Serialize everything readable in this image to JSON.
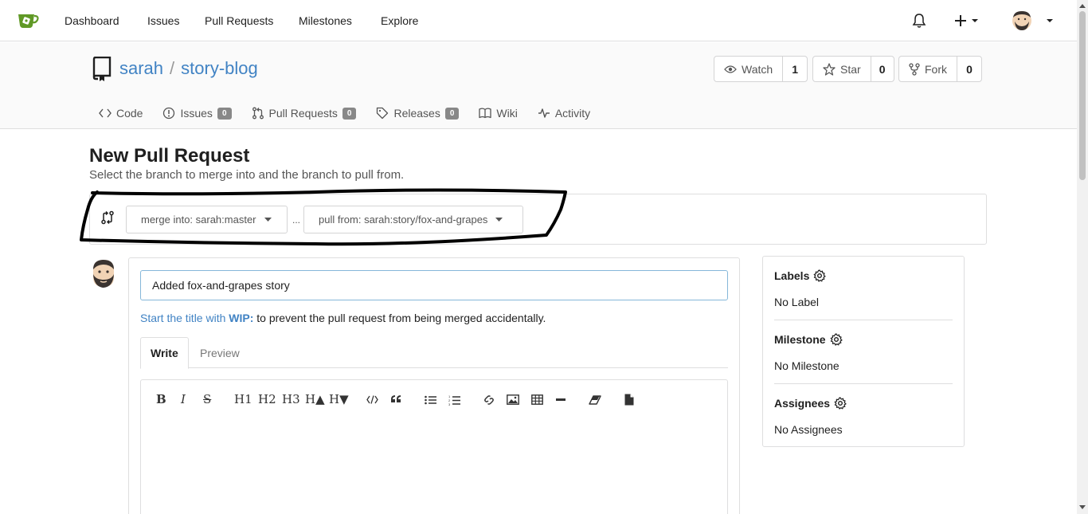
{
  "nav": {
    "items": [
      "Dashboard",
      "Issues",
      "Pull Requests",
      "Milestones",
      "Explore"
    ]
  },
  "repo": {
    "owner": "sarah",
    "separator": "/",
    "name": "story-blog",
    "watch_label": "Watch",
    "watch_count": "1",
    "star_label": "Star",
    "star_count": "0",
    "fork_label": "Fork",
    "fork_count": "0",
    "tabs": [
      {
        "label": "Code",
        "count": ""
      },
      {
        "label": "Issues",
        "count": "0"
      },
      {
        "label": "Pull Requests",
        "count": "0"
      },
      {
        "label": "Releases",
        "count": "0"
      },
      {
        "label": "Wiki",
        "count": ""
      },
      {
        "label": "Activity",
        "count": ""
      }
    ]
  },
  "page": {
    "title": "New Pull Request",
    "subtitle": "Select the branch to merge into and the branch to pull from."
  },
  "branches": {
    "merge_into": "merge into: sarah:master",
    "dots": "...",
    "pull_from": "pull from: sarah:story/fox-and-grapes"
  },
  "form": {
    "title_value": "Added fox-and-grapes story",
    "hint_link": "Start the title with",
    "hint_wip": "WIP:",
    "hint_rest": "to prevent the pull request from being merged accidentally.",
    "tab_write": "Write",
    "tab_preview": "Preview",
    "toolbar": [
      "B",
      "I",
      "S",
      "H1",
      "H2",
      "H3",
      "H▲",
      "H▼"
    ]
  },
  "sidebar": {
    "labels_title": "Labels",
    "labels_value": "No Label",
    "milestone_title": "Milestone",
    "milestone_value": "No Milestone",
    "assignees_title": "Assignees",
    "assignees_value": "No Assignees"
  },
  "colors": {
    "link": "#4183c4",
    "logo": "#609926",
    "badge": "#888888",
    "annotation": "#000000"
  }
}
